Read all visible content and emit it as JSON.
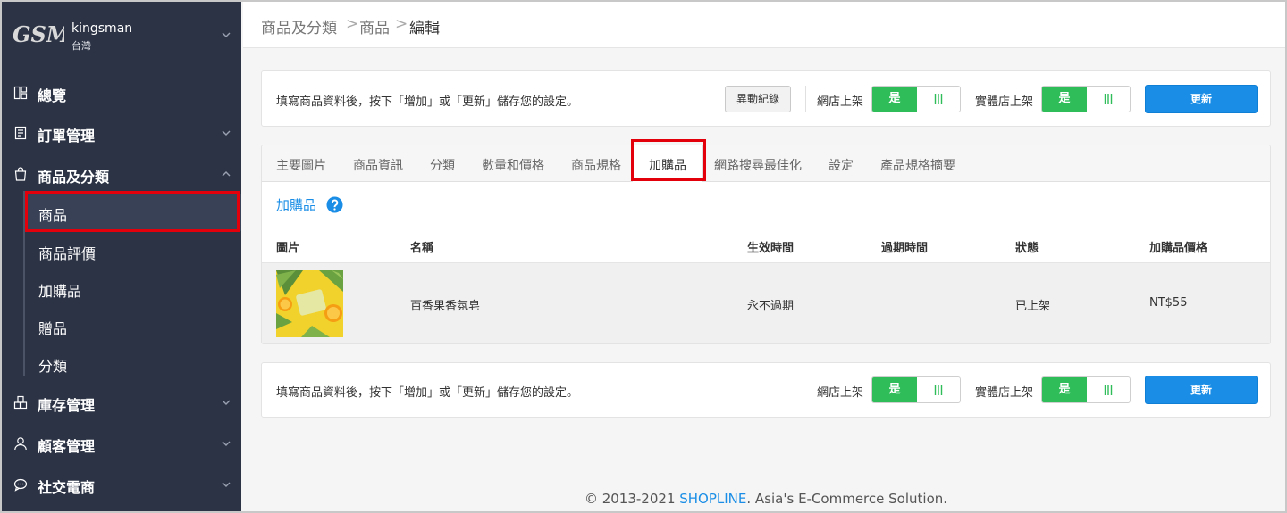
{
  "sidebar": {
    "logo_text": "GSM",
    "store_name": "kingsman",
    "store_region": "台灣",
    "items": [
      {
        "label": "總覽",
        "icon": "dashboard-icon"
      },
      {
        "label": "訂單管理",
        "icon": "receipt-icon"
      },
      {
        "label": "商品及分類",
        "icon": "shopping-bag-icon"
      },
      {
        "label": "庫存管理",
        "icon": "inventory-icon"
      },
      {
        "label": "顧客管理",
        "icon": "user-icon"
      },
      {
        "label": "社交電商",
        "icon": "chat-icon"
      }
    ],
    "subitems": [
      {
        "label": "商品",
        "active": true
      },
      {
        "label": "商品評價"
      },
      {
        "label": "加購品"
      },
      {
        "label": "贈品"
      },
      {
        "label": "分類"
      }
    ]
  },
  "breadcrumb": [
    "商品及分類",
    "商品",
    "編輯"
  ],
  "panels": {
    "top": {
      "message": "填寫商品資料後，按下「增加」或「更新」儲存您的設定。",
      "history_label": "異動紀錄",
      "online_label": "網店上架",
      "online_value": "是",
      "retail_label": "實體店上架",
      "retail_value": "是",
      "update_label": "更新"
    },
    "bottom": {
      "message": "填寫商品資料後，按下「增加」或「更新」儲存您的設定。",
      "online_label": "網店上架",
      "online_value": "是",
      "retail_label": "實體店上架",
      "retail_value": "是",
      "update_label": "更新"
    }
  },
  "tabs": [
    {
      "label": "主要圖片"
    },
    {
      "label": "商品資訊"
    },
    {
      "label": "分類"
    },
    {
      "label": "數量和價格"
    },
    {
      "label": "商品規格"
    },
    {
      "label": "加購品",
      "active": true
    },
    {
      "label": "網路搜尋最佳化"
    },
    {
      "label": "設定"
    },
    {
      "label": "產品規格摘要"
    }
  ],
  "addon": {
    "title": "加購品",
    "columns": [
      "圖片",
      "名稱",
      "生效時間",
      "過期時間",
      "狀態",
      "加購品價格"
    ],
    "rows": [
      {
        "name": "百香果香氛皂",
        "effective": "永不過期",
        "expiry": "",
        "status": "已上架",
        "price": "NT$55"
      }
    ]
  },
  "footer": {
    "prefix": "© 2013-2021 ",
    "brand": "SHOPLINE",
    "suffix": ". Asia's E-Commerce Solution."
  },
  "colors": {
    "sidebar_bg": "#2c3345",
    "accent_blue": "#1a8ee6",
    "toggle_green": "#2ebd59",
    "highlight_red": "#e3000b"
  }
}
